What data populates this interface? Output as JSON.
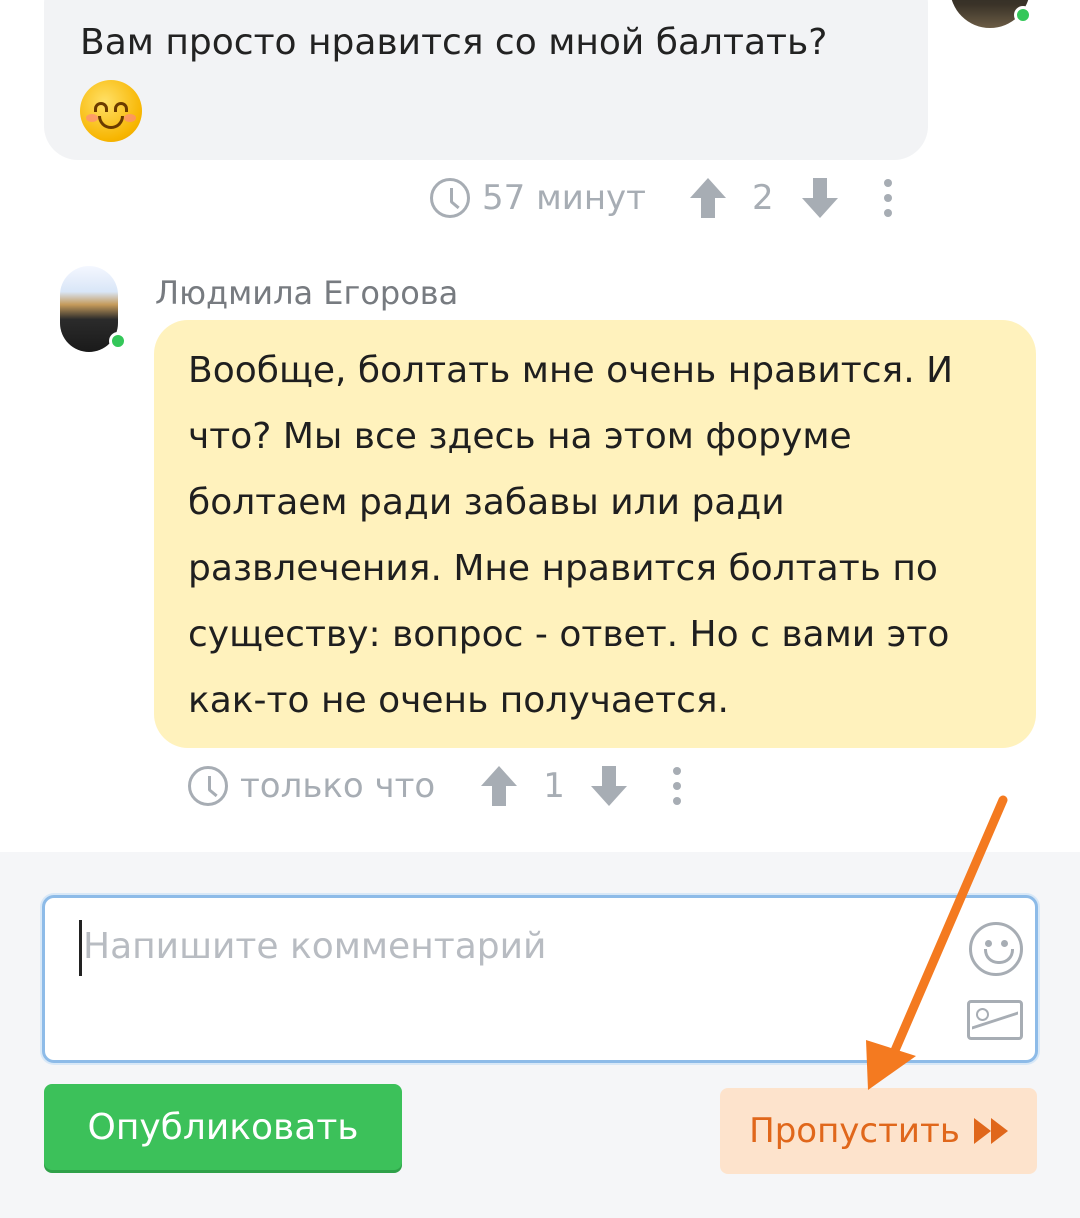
{
  "comments": [
    {
      "text": "Вам просто нравится со мной балтать?",
      "emoji": "smiling-face-emoji",
      "time": "57 минут",
      "votes": "2"
    },
    {
      "author": "Людмила Егорова",
      "text": "Вообще, болтать мне очень нравится. И что? Мы все здесь на этом форуме болтаем ради забавы или ради развлечения. Мне нравится болтать по существу: вопрос - ответ. Но с вами это как-то не очень получается.",
      "time": "только что",
      "votes": "1"
    }
  ],
  "form": {
    "placeholder": "Напишите комментарий",
    "publish_label": "Опубликовать",
    "skip_label": "Пропустить"
  },
  "icons": {
    "clock": "clock-icon",
    "upvote": "arrow-up-icon",
    "downvote": "arrow-down-icon",
    "more": "kebab-menu-icon",
    "smile": "smile-icon",
    "image": "image-icon",
    "skip": "fast-forward-icon"
  },
  "colors": {
    "publish": "#3cc15a",
    "skip_bg": "#fde3cc",
    "skip_text": "#e0671b",
    "reply_bubble": "#fff2bd",
    "online": "#34c759",
    "annotation_arrow": "#f47a20"
  }
}
